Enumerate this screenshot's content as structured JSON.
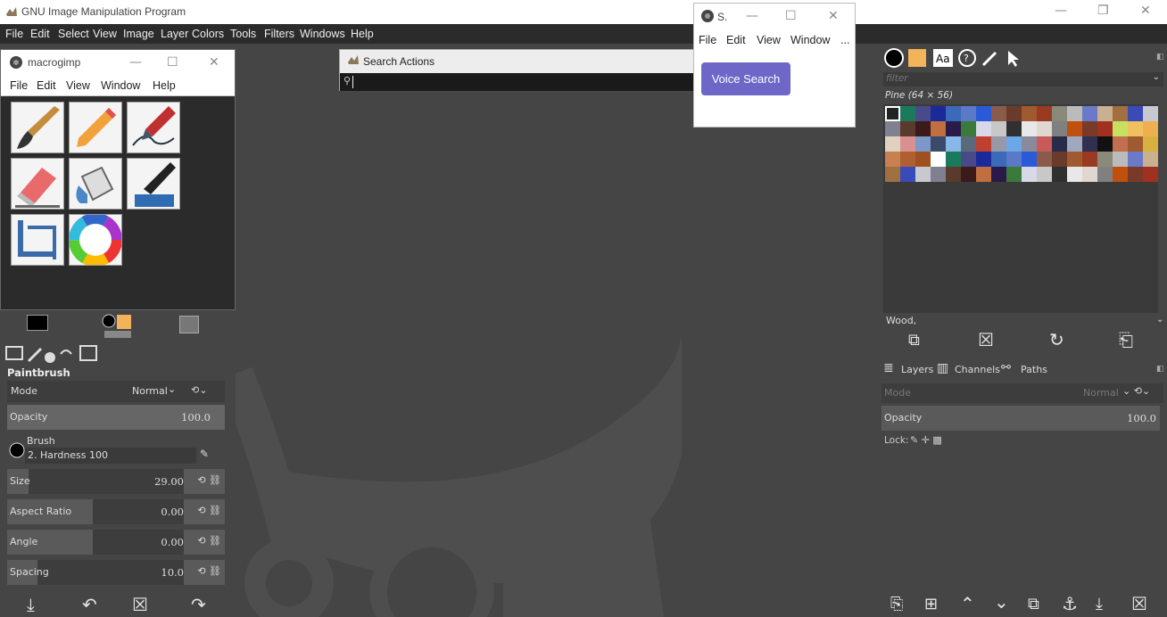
{
  "app": {
    "title": "GNU Image Manipulation Program"
  },
  "menubar": [
    "File",
    "Edit",
    "Select",
    "View",
    "Image",
    "Layer",
    "Colors",
    "Tools",
    "Filters",
    "Windows",
    "Help"
  ],
  "macro_window": {
    "title": "macrogimp",
    "menu": [
      "File",
      "Edit",
      "View",
      "Window",
      "Help"
    ]
  },
  "search": {
    "title": "Search Actions",
    "value": ""
  },
  "voice_window": {
    "title": "S.",
    "menu": [
      "File",
      "Edit",
      "View",
      "Window",
      "..."
    ],
    "button": "Voice Search",
    "accent": "#6e67c8"
  },
  "tool_options": {
    "header": "Paintbrush",
    "mode_label": "Mode",
    "mode_value": "Normal",
    "opacity_label": "Opacity",
    "opacity_value": "100.0",
    "brush_label": "Brush",
    "brush_value": "2. Hardness 100",
    "rows": [
      {
        "label": "Size",
        "value": "29.00"
      },
      {
        "label": "Aspect Ratio",
        "value": "0.00"
      },
      {
        "label": "Angle",
        "value": "0.00"
      },
      {
        "label": "Spacing",
        "value": "10.0"
      }
    ]
  },
  "patterns": {
    "filter_placeholder": "filter",
    "selected": "Pine (64 × 56)",
    "tag": "Wood,"
  },
  "layers": {
    "tabs": [
      "Layers",
      "Channels",
      "Paths"
    ],
    "mode_label": "Mode",
    "mode_value": "Normal",
    "opacity_label": "Opacity",
    "opacity_value": "100.0",
    "lock_label": "Lock:"
  }
}
